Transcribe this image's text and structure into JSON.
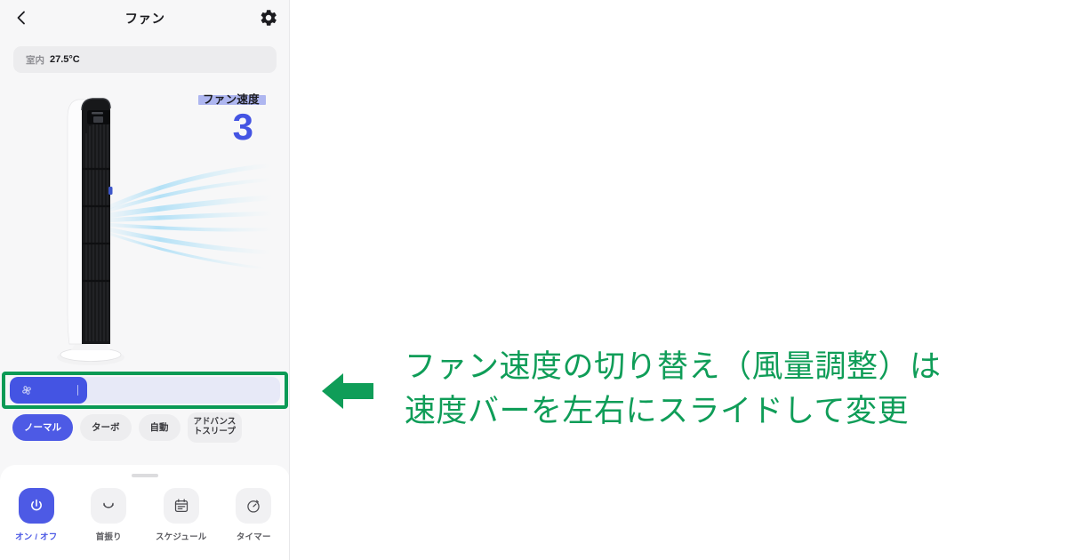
{
  "app": {
    "nav": {
      "back_icon": "chevron-left-icon",
      "title": "ファン",
      "settings_icon": "gear-icon"
    },
    "temperature": {
      "label": "室内",
      "value": "27.5°C"
    },
    "speed": {
      "label": "ファン速度",
      "value": "3",
      "highlight_color": "#aab2ef",
      "value_color": "#4454e3"
    },
    "slider": {
      "icon": "fan-blades-icon",
      "fill_percent": 29,
      "fill_color": "#4454e3",
      "track_color": "#e7e9f7"
    },
    "modes": [
      {
        "label": "ノーマル",
        "active": true
      },
      {
        "label": "ターボ",
        "active": false
      },
      {
        "label": "自動",
        "active": false
      },
      {
        "label_line1": "アドバンス",
        "label_line2": "トスリープ",
        "active": false
      }
    ],
    "tabs": [
      {
        "label": "オン / オフ",
        "icon": "power-icon",
        "active": true
      },
      {
        "label": "首振り",
        "icon": "oscillate-icon",
        "active": false
      },
      {
        "label": "スケジュール",
        "icon": "calendar-icon",
        "active": false
      },
      {
        "label": "タイマー",
        "icon": "timer-icon",
        "active": false
      }
    ]
  },
  "annotation": {
    "arrow_icon": "arrow-left-icon",
    "color": "#0f9d58",
    "line1": "ファン速度の切り替え（風量調整）は",
    "line2": "速度バーを左右にスライドして変更"
  }
}
